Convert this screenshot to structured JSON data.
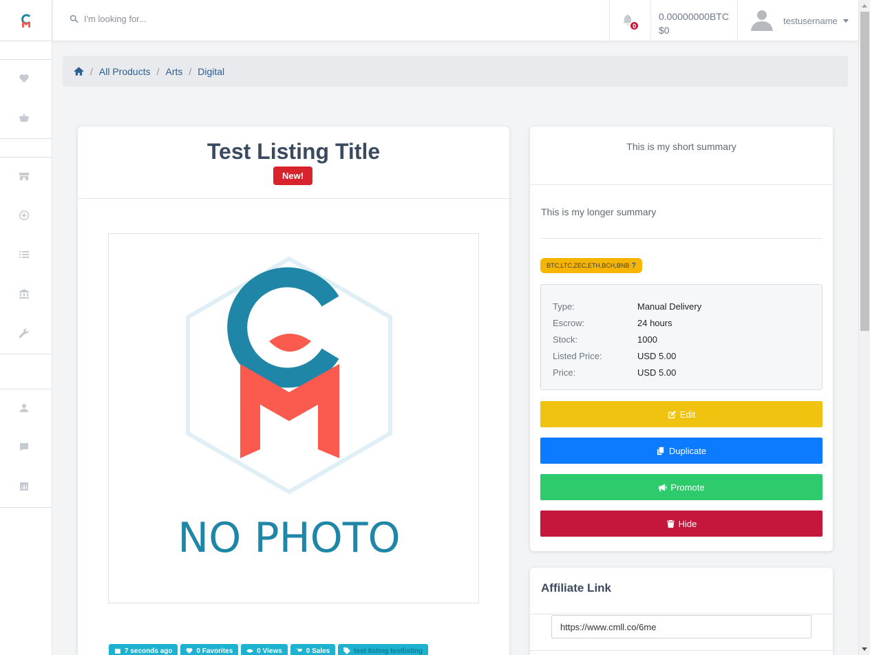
{
  "search": {
    "placeholder": "I'm looking for..."
  },
  "header": {
    "notification_count": "0",
    "balance_btc": "0.00000000BTC",
    "balance_usd": "$0",
    "username": "testusername"
  },
  "breadcrumb": {
    "items": [
      "All Products",
      "Arts",
      "Digital"
    ],
    "separator": "/"
  },
  "listing": {
    "title": "Test Listing Title",
    "badge": "New!",
    "photo_text": "NO PHOTO",
    "tags": [
      "7 seconds ago",
      "0 Favorites",
      "0 Views",
      "0 Sales",
      "test listing testlisting"
    ]
  },
  "summary": {
    "short": "This is my short summary",
    "long": "This is my longer summary",
    "currencies": "BTC,LTC,ZEC,ETH,BCH,BNB",
    "currencies_help": "?"
  },
  "details": [
    {
      "label": "Type:",
      "value": "Manual Delivery"
    },
    {
      "label": "Escrow:",
      "value": "24 hours"
    },
    {
      "label": "Stock:",
      "value": "1000"
    },
    {
      "label": "Listed Price:",
      "value": "USD 5.00"
    },
    {
      "label": "Price:",
      "value": "USD 5.00"
    }
  ],
  "actions": {
    "edit": "Edit",
    "duplicate": "Duplicate",
    "promote": "Promote",
    "hide": "Hide"
  },
  "affiliate": {
    "title": "Affiliate Link",
    "url": "https://www.cmll.co/6me"
  },
  "colors": {
    "brand_teal": "#1f86a8",
    "brand_coral": "#fb5a4e",
    "new_badge": "#d9232c",
    "edit": "#efc30f",
    "duplicate": "#0d7bff",
    "promote": "#2ecb6d",
    "hide": "#c5173c",
    "tag": "#1db2cf"
  }
}
